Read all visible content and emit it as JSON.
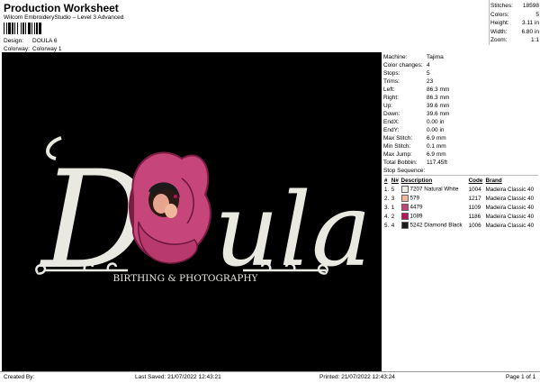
{
  "header": {
    "title": "Production Worksheet",
    "subtitle": "Wilcom EmbroideryStudio – Level 3 Advanced",
    "design_label": "Design:",
    "design_value": "DOULA 6",
    "colorway_label": "Colorway:",
    "colorway_value": "Colorway 1"
  },
  "stats": [
    {
      "label": "Stitches:",
      "value": "18598"
    },
    {
      "label": "Colors:",
      "value": "5"
    },
    {
      "label": "Height:",
      "value": "3.11 in"
    },
    {
      "label": "Width:",
      "value": "6.80 in"
    },
    {
      "label": "Zoom:",
      "value": "1:1"
    }
  ],
  "design": {
    "word_left": "D",
    "word_right": "ula",
    "tagline": "BIRTHING & PHOTOGRAPHY",
    "colors": {
      "thread_white": "#e9e9e2",
      "rose": "#c7467a",
      "rose_dark": "#7a1c44",
      "background": "#000000"
    }
  },
  "machine": [
    {
      "label": "Machine:",
      "value": "Tajima"
    },
    {
      "label": "Color changes:",
      "value": "4"
    },
    {
      "label": "Stops:",
      "value": "5"
    },
    {
      "label": "Trims:",
      "value": "23"
    },
    {
      "label": "Left:",
      "value": "86.3 mm"
    },
    {
      "label": "Right:",
      "value": "86.3 mm"
    },
    {
      "label": "Up:",
      "value": "39.6 mm"
    },
    {
      "label": "Down:",
      "value": "39.6 mm"
    },
    {
      "label": "EndX:",
      "value": "0.00 in"
    },
    {
      "label": "EndY:",
      "value": "0.00 in"
    },
    {
      "label": "Max Stitch:",
      "value": "6.9 mm"
    },
    {
      "label": "Min Stitch:",
      "value": "0.1 mm"
    },
    {
      "label": "Max Jump:",
      "value": "6.9 mm"
    },
    {
      "label": "Total Bobbin:",
      "value": "117.45ft"
    }
  ],
  "stop_sequence": {
    "title": "Stop Sequence:",
    "headers": [
      "#",
      "N#",
      "Description",
      "Code",
      "Brand"
    ],
    "rows": [
      {
        "idx": "1.",
        "n": "5",
        "swatch": "#ecebe4",
        "num": "7207",
        "desc": "Natural White",
        "code": "1004",
        "brand": "Madeira Classic 40"
      },
      {
        "idx": "2.",
        "n": "3",
        "swatch": "#f0b89a",
        "num": "579",
        "desc": "",
        "code": "1217",
        "brand": "Madeira Classic 40"
      },
      {
        "idx": "3.",
        "n": "1",
        "swatch": "#c34178",
        "num": "4479",
        "desc": "",
        "code": "1109",
        "brand": "Madeira Classic 40"
      },
      {
        "idx": "4.",
        "n": "2",
        "swatch": "#c0105c",
        "num": "1089",
        "desc": "",
        "code": "1186",
        "brand": "Madeira Classic 40"
      },
      {
        "idx": "5.",
        "n": "4",
        "swatch": "#1a1a1a",
        "num": "5242",
        "desc": "Diamond Black",
        "code": "1006",
        "brand": "Madeira Classic 40"
      }
    ]
  },
  "footer": {
    "created": "Created By:",
    "saved": "Last Saved: 21/07/2022 12:43:21",
    "printed": "Printed: 21/07/2022 12:43:24",
    "page": "Page 1 of 1"
  }
}
